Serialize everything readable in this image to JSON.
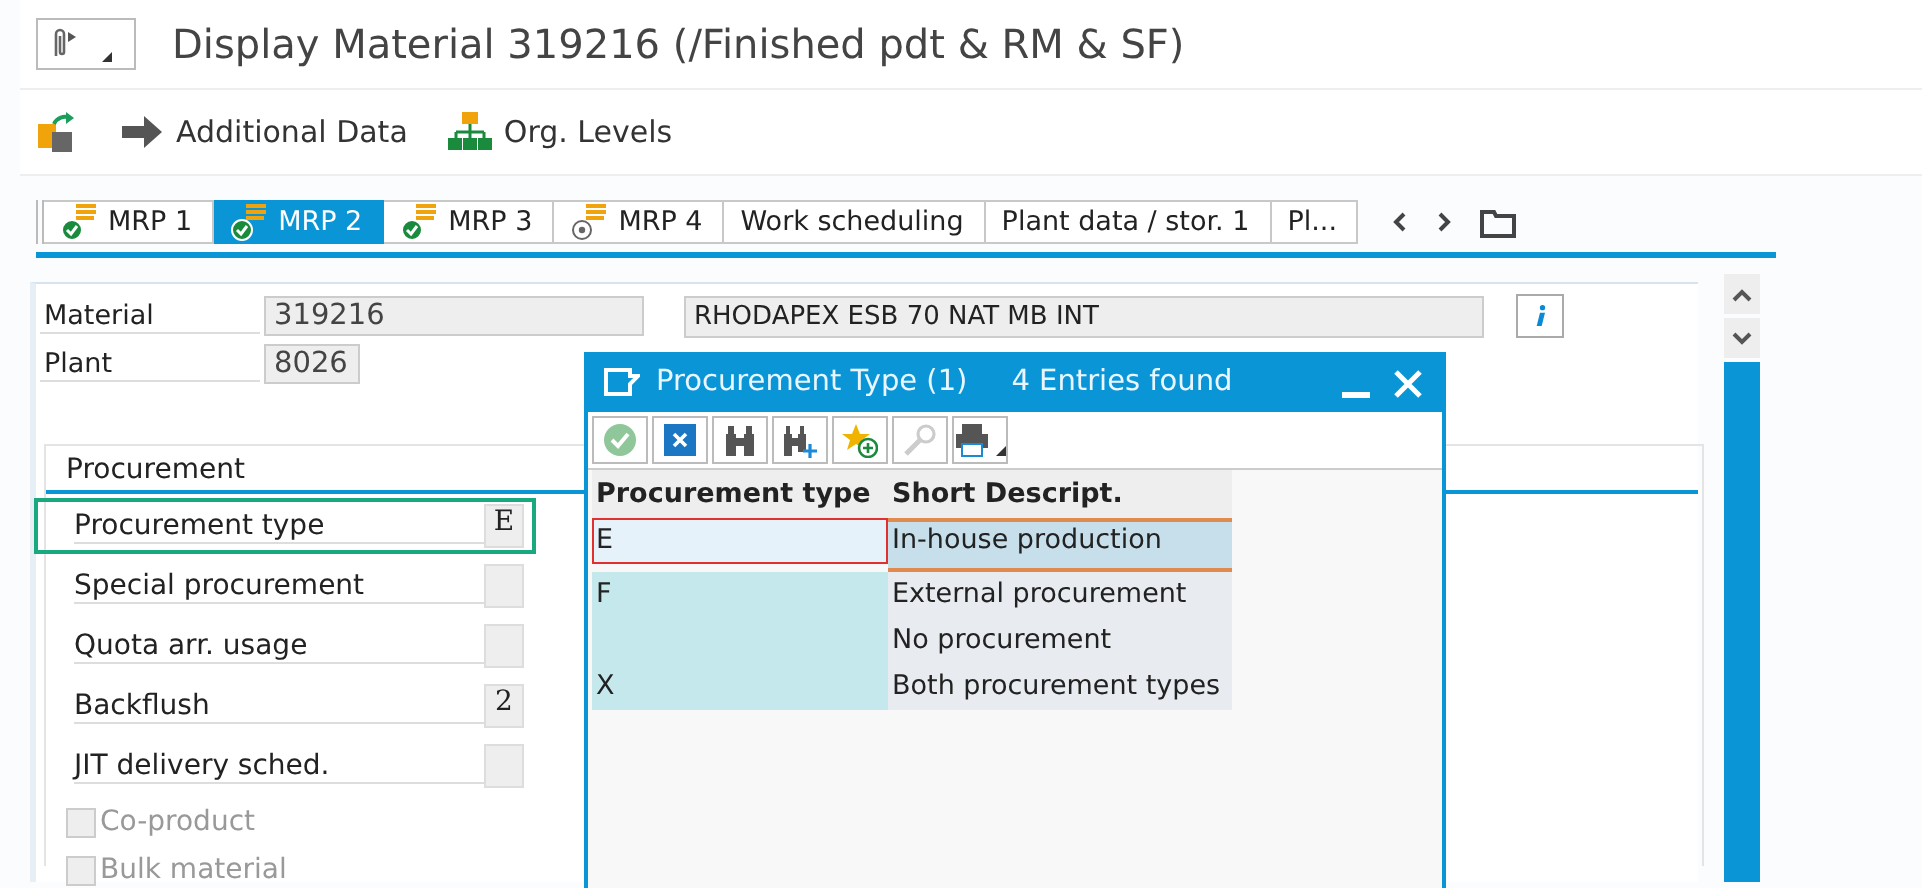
{
  "window": {
    "title": "Display Material 319216 (/Finished pdt & RM & SF)"
  },
  "toolbar": [
    {
      "kind": "switch"
    },
    {
      "kind": "arrow",
      "label": "Additional Data"
    },
    {
      "kind": "org",
      "label": "Org. Levels"
    }
  ],
  "tabs": [
    {
      "label": "MRP 1",
      "kind": "ok",
      "selected": false
    },
    {
      "label": "MRP 2",
      "kind": "ok",
      "selected": true
    },
    {
      "label": "MRP 3",
      "kind": "ok",
      "selected": false
    },
    {
      "label": "MRP 4",
      "kind": "open",
      "selected": false
    },
    {
      "label": "Work scheduling",
      "kind": "plain",
      "selected": false
    },
    {
      "label": "Plant data / stor. 1",
      "kind": "plain",
      "selected": false
    },
    {
      "label": "Pl...",
      "kind": "plain",
      "selected": false
    }
  ],
  "header": {
    "material_label": "Material",
    "material": "319216",
    "description": "RHODAPEX ESB 70 NAT MB INT",
    "plant_label": "Plant",
    "plant": "8026"
  },
  "procurement": {
    "title": "Procurement",
    "fields": [
      {
        "label": "Procurement type",
        "value": "E",
        "highlighted": true
      },
      {
        "label": "Special procurement",
        "highlighted": false
      },
      {
        "label": "Quota arr. usage",
        "highlighted": false
      },
      {
        "label": "Backflush",
        "value": "2",
        "highlighted": false
      },
      {
        "label": "JIT delivery sched.",
        "highlighted": false
      }
    ],
    "checkboxes": [
      {
        "label": "Co-product",
        "checked": false,
        "disabled": true
      },
      {
        "label": "Bulk material",
        "checked": false,
        "disabled": true
      }
    ]
  },
  "popup": {
    "title": "Procurement Type (1)",
    "count": "4 Entries found",
    "columns": [
      "Procurement type",
      "Short Descript."
    ],
    "rows": [
      {
        "code": "E",
        "text": "In-house production",
        "selected": true
      },
      {
        "code": "F",
        "text": "External procurement",
        "selected": false
      },
      {
        "code": "",
        "text": "No procurement",
        "selected": false
      },
      {
        "code": "X",
        "text": "Both procurement types",
        "selected": false
      }
    ]
  }
}
